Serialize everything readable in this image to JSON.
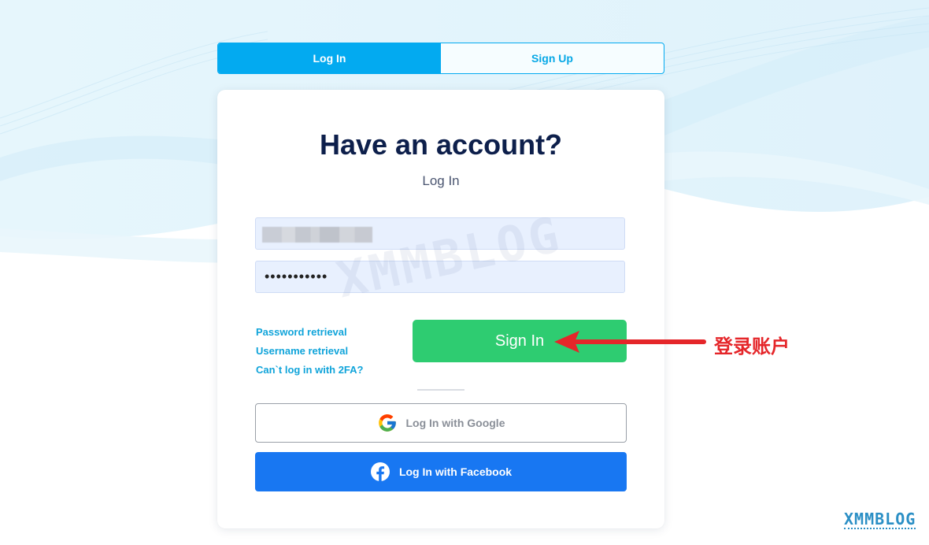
{
  "tabs": [
    {
      "label": "Log In",
      "active": true
    },
    {
      "label": "Sign Up",
      "active": false
    }
  ],
  "card": {
    "title": "Have an account?",
    "subtitle": "Log In"
  },
  "form": {
    "username_value": "",
    "password_value": "•••••••••••"
  },
  "links": {
    "password_retrieval": "Password retrieval",
    "username_retrieval": "Username retrieval",
    "cant_login_2fa": "Can`t log in with 2FA?"
  },
  "buttons": {
    "sign_in": "Sign In",
    "google": "Log In with Google",
    "facebook": "Log In with Facebook"
  },
  "icons": {
    "google": "google-logo-icon",
    "facebook": "facebook-logo-icon"
  },
  "annotation": {
    "text": "登录账户"
  },
  "watermark": {
    "center": "XMMBLOG",
    "corner": "XMMBLOG"
  },
  "colors": {
    "primary": "#03aaf0",
    "sign_in": "#2ecc71",
    "facebook": "#1877f2",
    "title": "#0d1f4b",
    "annotation": "#e5262a"
  }
}
